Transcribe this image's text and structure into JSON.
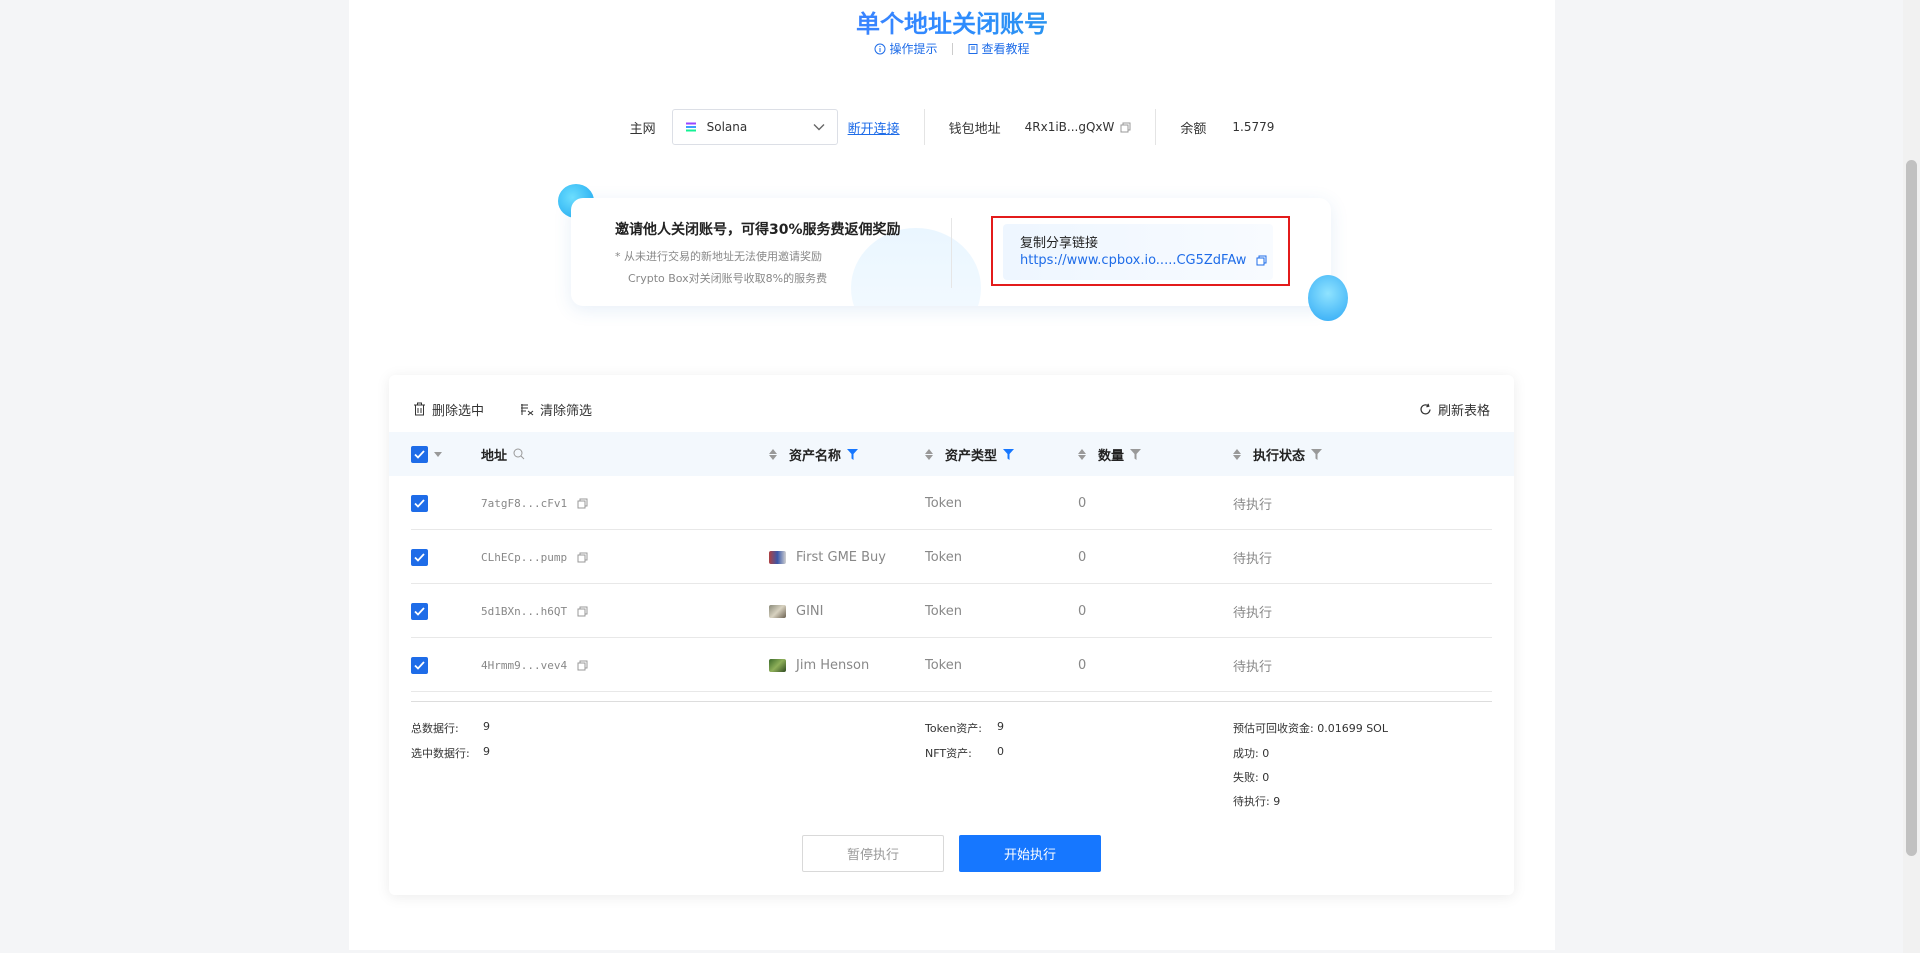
{
  "header": {
    "title": "单个地址关闭账号",
    "links": [
      {
        "label": "操作提示",
        "icon": "info-icon"
      },
      {
        "label": "查看教程",
        "icon": "book-icon"
      }
    ]
  },
  "network": {
    "label": "主网",
    "selected": "Solana",
    "disconnect_label": "断开连接",
    "wallet_label": "钱包地址",
    "wallet_address": "4Rx1iB...gQxW",
    "balance_label": "余额",
    "balance_value": "1.5779"
  },
  "invite": {
    "title": "邀请他人关闭账号，可得30%服务费返佣奖励",
    "note1": "* 从未进行交易的新地址无法使用邀请奖励",
    "note2": "Crypto Box对关闭账号收取8%的服务费",
    "share_label": "复制分享链接",
    "share_link": "https://www.cpbox.io.....CG5ZdFAw"
  },
  "toolbar": {
    "delete_label": "删除选中",
    "clear_filter_label": "清除筛选",
    "refresh_label": "刷新表格"
  },
  "table": {
    "columns": [
      "地址",
      "资产名称",
      "资产类型",
      "数量",
      "执行状态"
    ],
    "rows": [
      {
        "address": "7atgF8...cFv1",
        "asset_name": "",
        "asset_type": "Token",
        "amount": "0",
        "status": "待执行"
      },
      {
        "address": "CLhECp...pump",
        "asset_name": "First GME Buy",
        "asset_type": "Token",
        "amount": "0",
        "status": "待执行"
      },
      {
        "address": "5d1BXn...h6QT",
        "asset_name": "GINI",
        "asset_type": "Token",
        "amount": "0",
        "status": "待执行"
      },
      {
        "address": "4Hrmm9...vev4",
        "asset_name": "Jim Henson",
        "asset_type": "Token",
        "amount": "0",
        "status": "待执行"
      }
    ]
  },
  "stats": {
    "total_label": "总数据行:",
    "total_value": "9",
    "selected_label": "选中数据行:",
    "selected_value": "9",
    "token_label": "Token资产:",
    "token_value": "9",
    "nft_label": "NFT资产:",
    "nft_value": "0",
    "recover_label": "预估可回收资金:",
    "recover_value": "0.01699 SOL",
    "success_label": "成功:",
    "success_value": "0",
    "fail_label": "失败:",
    "fail_value": "0",
    "pending_label": "待执行:",
    "pending_value": "9"
  },
  "actions": {
    "pause_label": "暂停执行",
    "start_label": "开始执行"
  },
  "colors": {
    "accent": "#1677ff",
    "highlight_border": "#e31b1b"
  }
}
